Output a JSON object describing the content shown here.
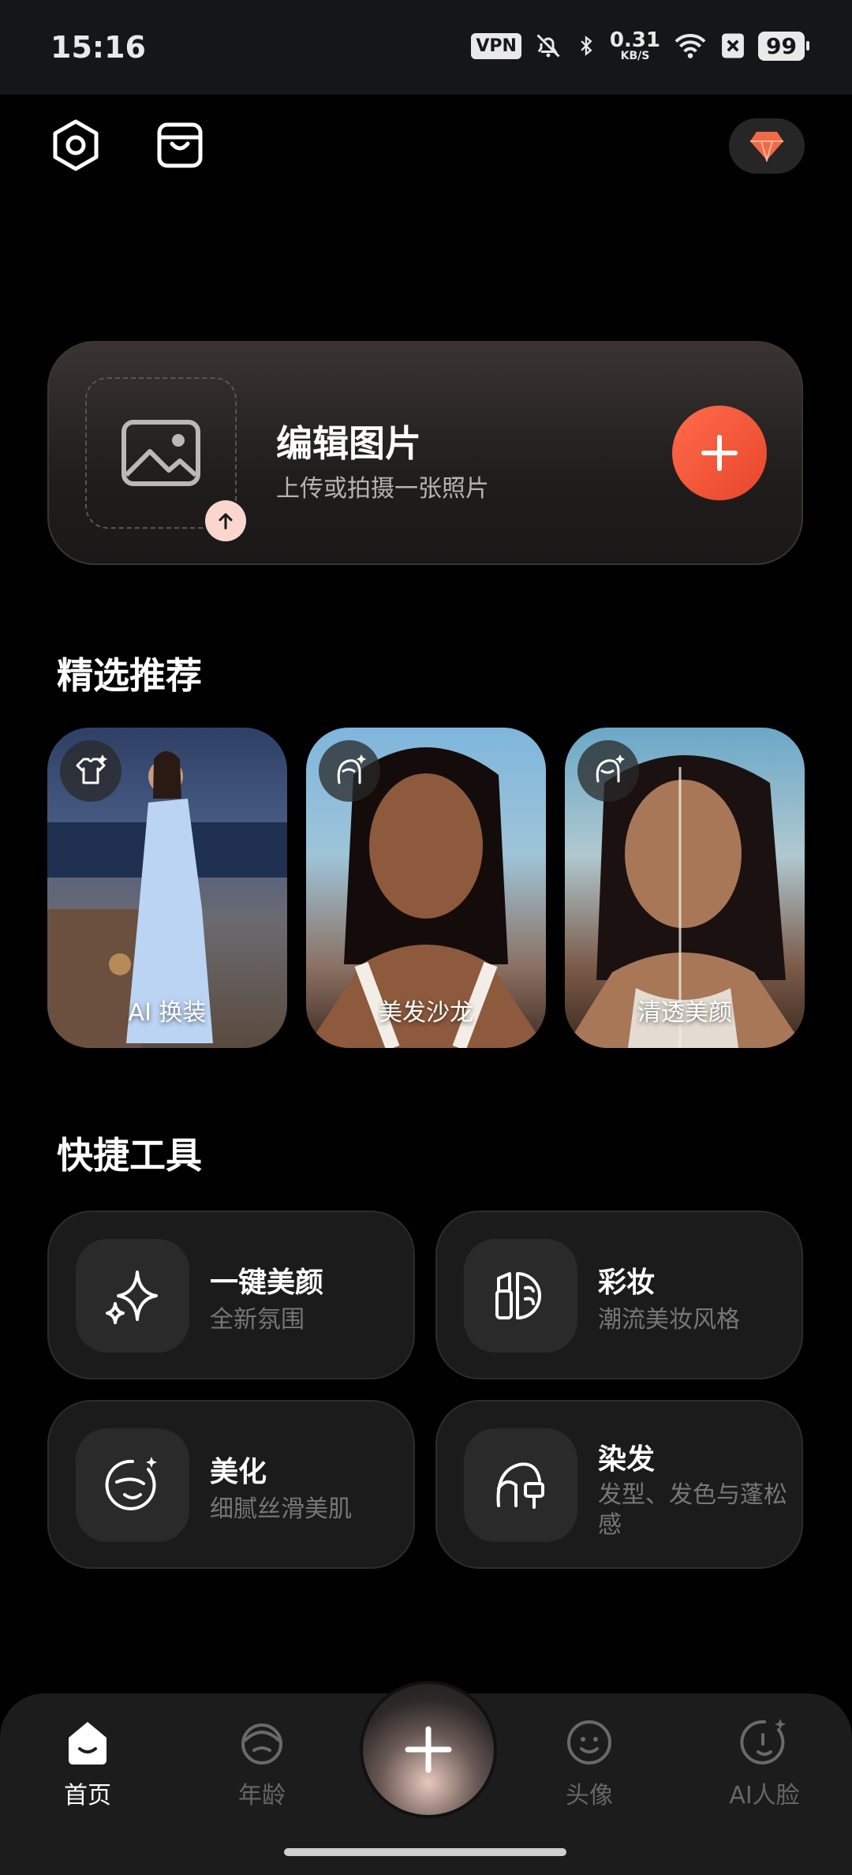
{
  "status_bar": {
    "time": "15:16",
    "vpn": "VPN",
    "net_speed_value": "0.31",
    "net_speed_unit": "KB/S",
    "battery": "99"
  },
  "edit_card": {
    "title": "编辑图片",
    "subtitle": "上传或拍摄一张照片"
  },
  "featured": {
    "section_title": "精选推荐",
    "items": [
      {
        "label": "AI 换装",
        "icon": "tshirt-sparkle-icon"
      },
      {
        "label": "美发沙龙",
        "icon": "hair-sparkle-icon"
      },
      {
        "label": "清透美颜",
        "icon": "face-sparkle-icon"
      }
    ]
  },
  "tools": {
    "section_title": "快捷工具",
    "items": [
      {
        "title": "一键美颜",
        "subtitle": "全新氛围",
        "icon": "sparkles-icon"
      },
      {
        "title": "彩妆",
        "subtitle": "潮流美妆风格",
        "icon": "lipstick-icon"
      },
      {
        "title": "美化",
        "subtitle": "细腻丝滑美肌",
        "icon": "face-smooth-icon"
      },
      {
        "title": "染发",
        "subtitle": "发型、发色与蓬松感",
        "icon": "hair-dye-icon"
      }
    ]
  },
  "bottom_nav": {
    "items": [
      {
        "label": "首页",
        "icon": "home-icon",
        "active": true
      },
      {
        "label": "年龄",
        "icon": "age-face-icon",
        "active": false
      },
      {
        "label": "头像",
        "icon": "avatar-face-icon",
        "active": false
      },
      {
        "label": "AI人脸",
        "icon": "ai-face-icon",
        "active": false
      }
    ]
  },
  "colors": {
    "accent": "#F0553A",
    "background": "#000000",
    "card": "#1B1B1B"
  }
}
